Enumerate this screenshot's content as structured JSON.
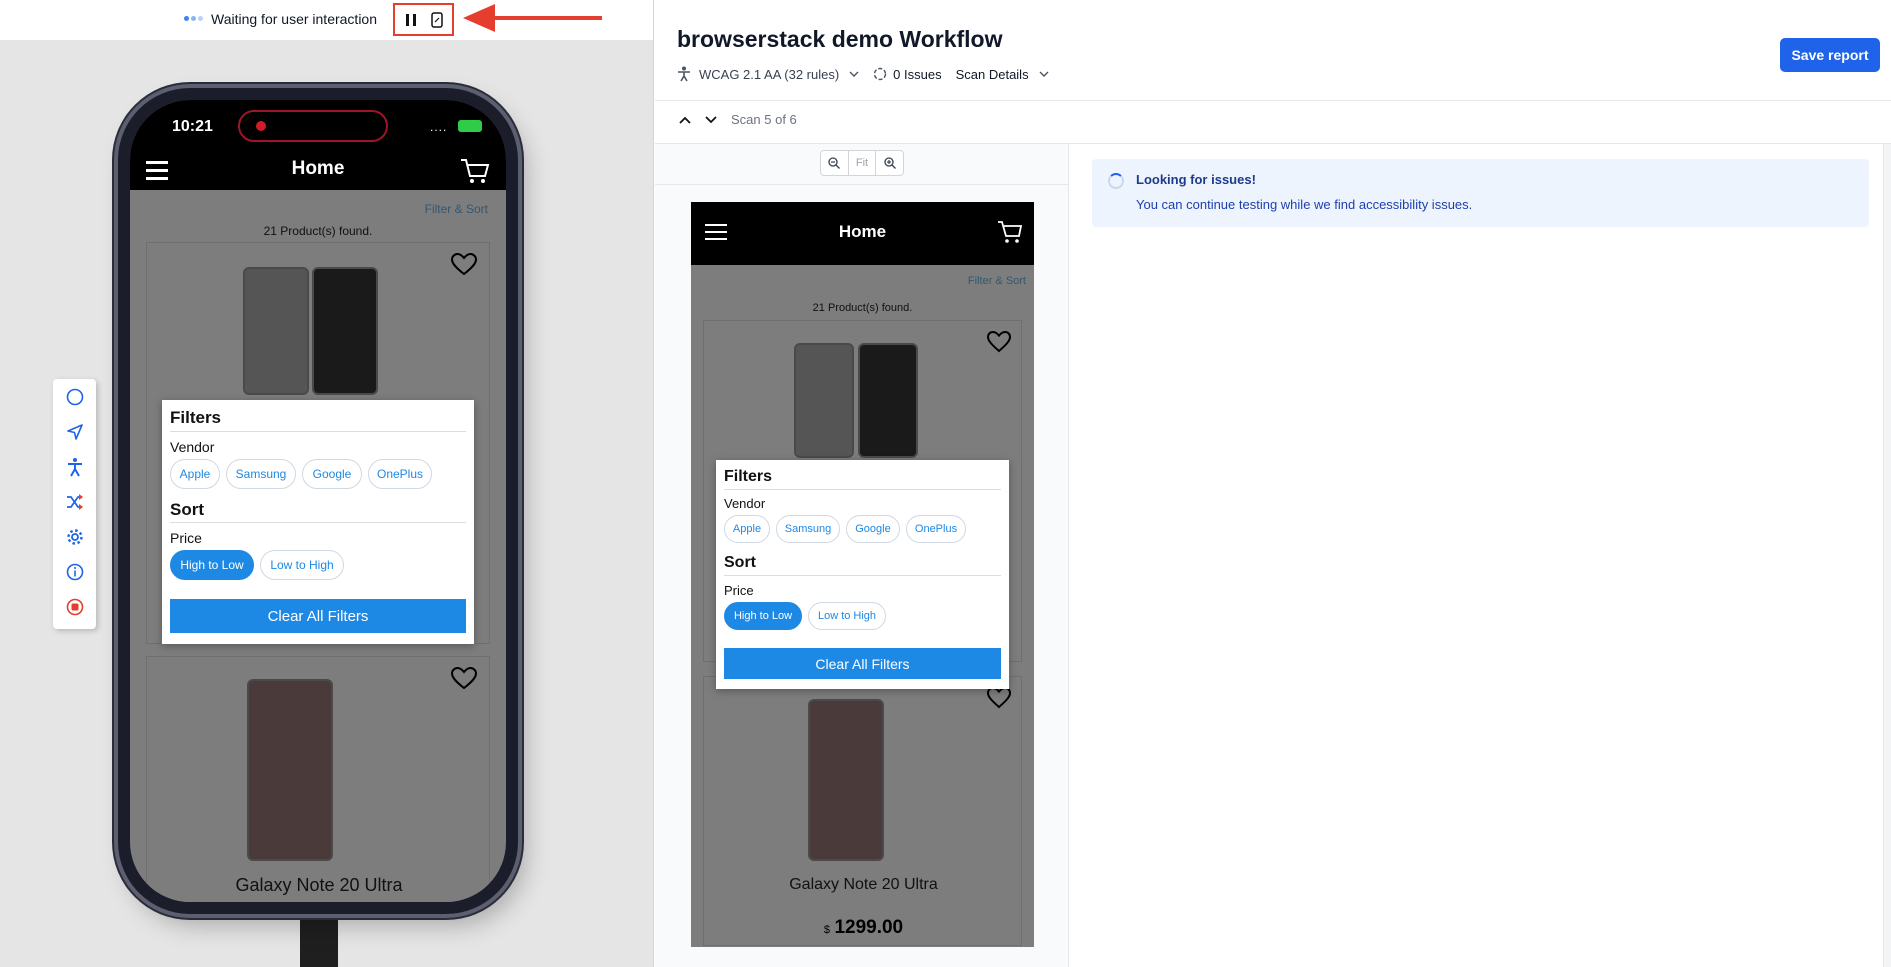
{
  "topbar": {
    "status_text": "Waiting for user interaction"
  },
  "phone": {
    "time": "10:21",
    "signal": "....",
    "header_title": "Home",
    "filter_sort": "Filter & Sort",
    "products_found": "21 Product(s) found.",
    "product_name": "Galaxy Note 20 Ultra",
    "price_currency": "$",
    "price_value": "1299.00"
  },
  "filters": {
    "title": "Filters",
    "vendor_label": "Vendor",
    "vendors": [
      "Apple",
      "Samsung",
      "Google",
      "OnePlus"
    ],
    "sort_title": "Sort",
    "price_label": "Price",
    "sort_options": [
      "High to Low",
      "Low to High"
    ],
    "selected_sort": "High to Low",
    "clear_label": "Clear All Filters"
  },
  "toolbar_icons": [
    "circle-icon",
    "navigate-icon",
    "accessibility-icon",
    "shuffle-icon",
    "gear-icon",
    "info-icon",
    "stop-record-icon"
  ],
  "report": {
    "title": "browserstack demo Workflow",
    "ruleset": "WCAG 2.1 AA (32 rules)",
    "issues": "0 Issues",
    "scan_details": "Scan Details",
    "save_label": "Save report",
    "scan_position": "Scan 5 of 6",
    "zoom_fit": "Fit",
    "alert_title": "Looking for issues!",
    "alert_body": "You can continue testing while we find accessibility issues."
  },
  "colors": {
    "accent": "#1e63e9",
    "highlight_red": "#e53e2e",
    "chip_blue": "#1e88e5",
    "alert_bg": "#eef4fd"
  }
}
